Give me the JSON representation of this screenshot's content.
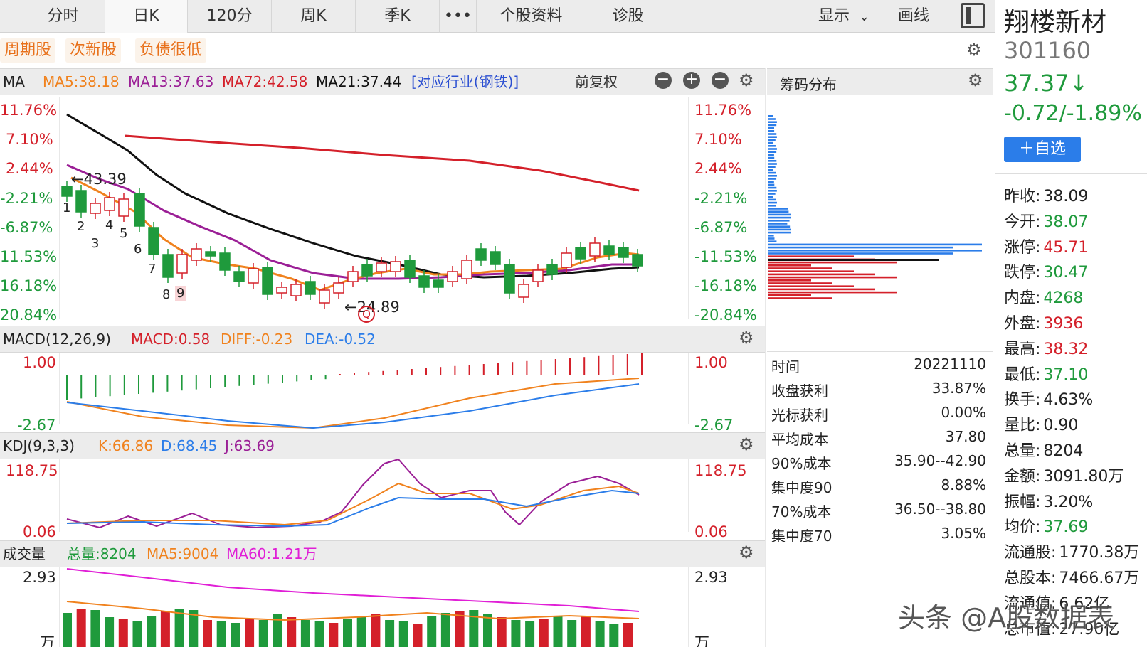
{
  "tabs": [
    "分时",
    "日K",
    "120分",
    "周K",
    "季K",
    "•••",
    "个股资料",
    "诊股"
  ],
  "active_tab": "日K",
  "toolbar": {
    "display_label": "显示",
    "draw_label": "画线"
  },
  "tags": [
    "周期股",
    "次新股",
    "负债很低"
  ],
  "ma_header": {
    "name": "MA",
    "ma5": "MA5:38.18",
    "ma13": "MA13:37.63",
    "ma72": "MA72:42.58",
    "ma21": "MA21:37.44",
    "industry": "[对应行业(钢铁)]",
    "adjust": "前复权"
  },
  "price_axis": [
    "11.76%",
    "7.10%",
    "2.44%",
    "-2.21%",
    "-6.87%",
    "-11.53%",
    "-16.18%",
    "-20.84%"
  ],
  "price_axis_left": [
    "11.76%",
    "7.10%",
    "2.44%",
    "-2.21%",
    "-6.87%",
    "11.53%",
    "16.18%",
    "20.84%"
  ],
  "annotations": {
    "high": "←43.39",
    "low": "←24.89",
    "seq": [
      "1",
      "2",
      "3",
      "4",
      "5",
      "6",
      "7",
      "8",
      "9"
    ],
    "q": "Q"
  },
  "chip_title": "筹码分布",
  "macd_header": {
    "name": "MACD(12,26,9)",
    "macd": "MACD:0.58",
    "diff": "DIFF:-0.23",
    "dea": "DEA:-0.52"
  },
  "macd_axis": {
    "top": "1.00",
    "bottom": "-2.67"
  },
  "kdj_header": {
    "name": "KDJ(9,3,3)",
    "k": "K:66.86",
    "d": "D:68.45",
    "j": "J:63.69"
  },
  "kdj_axis": {
    "top": "118.75",
    "bottom": "0.06"
  },
  "vol_header": {
    "name": "成交量",
    "total": "总量:8204",
    "ma5": "MA5:9004",
    "ma60": "MA60:1.21万"
  },
  "vol_axis": {
    "top": "2.93",
    "unit": "万"
  },
  "chip_stats": [
    {
      "k": "时间",
      "v": "20221110"
    },
    {
      "k": "收盘获利",
      "v": "33.87%"
    },
    {
      "k": "光标获利",
      "v": "0.00%"
    },
    {
      "k": "平均成本",
      "v": "37.80"
    },
    {
      "k": "90%成本",
      "v": "35.90--42.90"
    },
    {
      "k": "集中度90",
      "v": "8.88%"
    },
    {
      "k": "70%成本",
      "v": "36.50--38.80"
    },
    {
      "k": "集中度70",
      "v": "3.05%"
    }
  ],
  "stock": {
    "name": "翔楼新材",
    "code": "301160",
    "price": "37.37↓",
    "change": "-0.72/-1.89%",
    "watch_button": "＋自选"
  },
  "quote": [
    {
      "k": "昨收:",
      "v": "38.09",
      "c": "blk"
    },
    {
      "k": "今开:",
      "v": "38.07",
      "c": "green"
    },
    {
      "k": "涨停:",
      "v": "45.71",
      "c": "red"
    },
    {
      "k": "跌停:",
      "v": "30.47",
      "c": "green"
    },
    {
      "k": "内盘:",
      "v": "4268",
      "c": "green"
    },
    {
      "k": "外盘:",
      "v": "3936",
      "c": "red"
    },
    {
      "k": "最高:",
      "v": "38.32",
      "c": "red"
    },
    {
      "k": "最低:",
      "v": "37.10",
      "c": "green"
    },
    {
      "k": "换手:",
      "v": "4.63%",
      "c": "blk"
    },
    {
      "k": "量比:",
      "v": "0.90",
      "c": "blk"
    },
    {
      "k": "总量:",
      "v": "8204",
      "c": "blk"
    },
    {
      "k": "金额:",
      "v": "3091.80万",
      "c": "blk"
    },
    {
      "k": "振幅:",
      "v": "3.20%",
      "c": "blk"
    },
    {
      "k": "均价:",
      "v": "37.69",
      "c": "green"
    },
    {
      "k": "流通股:",
      "v": "1770.38万",
      "c": "blk"
    },
    {
      "k": "总股本:",
      "v": "7466.67万",
      "c": "blk"
    },
    {
      "k": "流通值:",
      "v": "6.62亿",
      "c": "blk"
    },
    {
      "k": "总市值:",
      "v": "27.90亿",
      "c": "blk"
    }
  ],
  "watermark": "头条 @A股数据表",
  "colors": {
    "up": "#d4202a",
    "down": "#1f9a3c",
    "ma5": "#f0821e",
    "ma13": "#9b1f96",
    "ma21": "#111111",
    "ma72": "#d4202a",
    "blue": "#2b7de9"
  }
}
